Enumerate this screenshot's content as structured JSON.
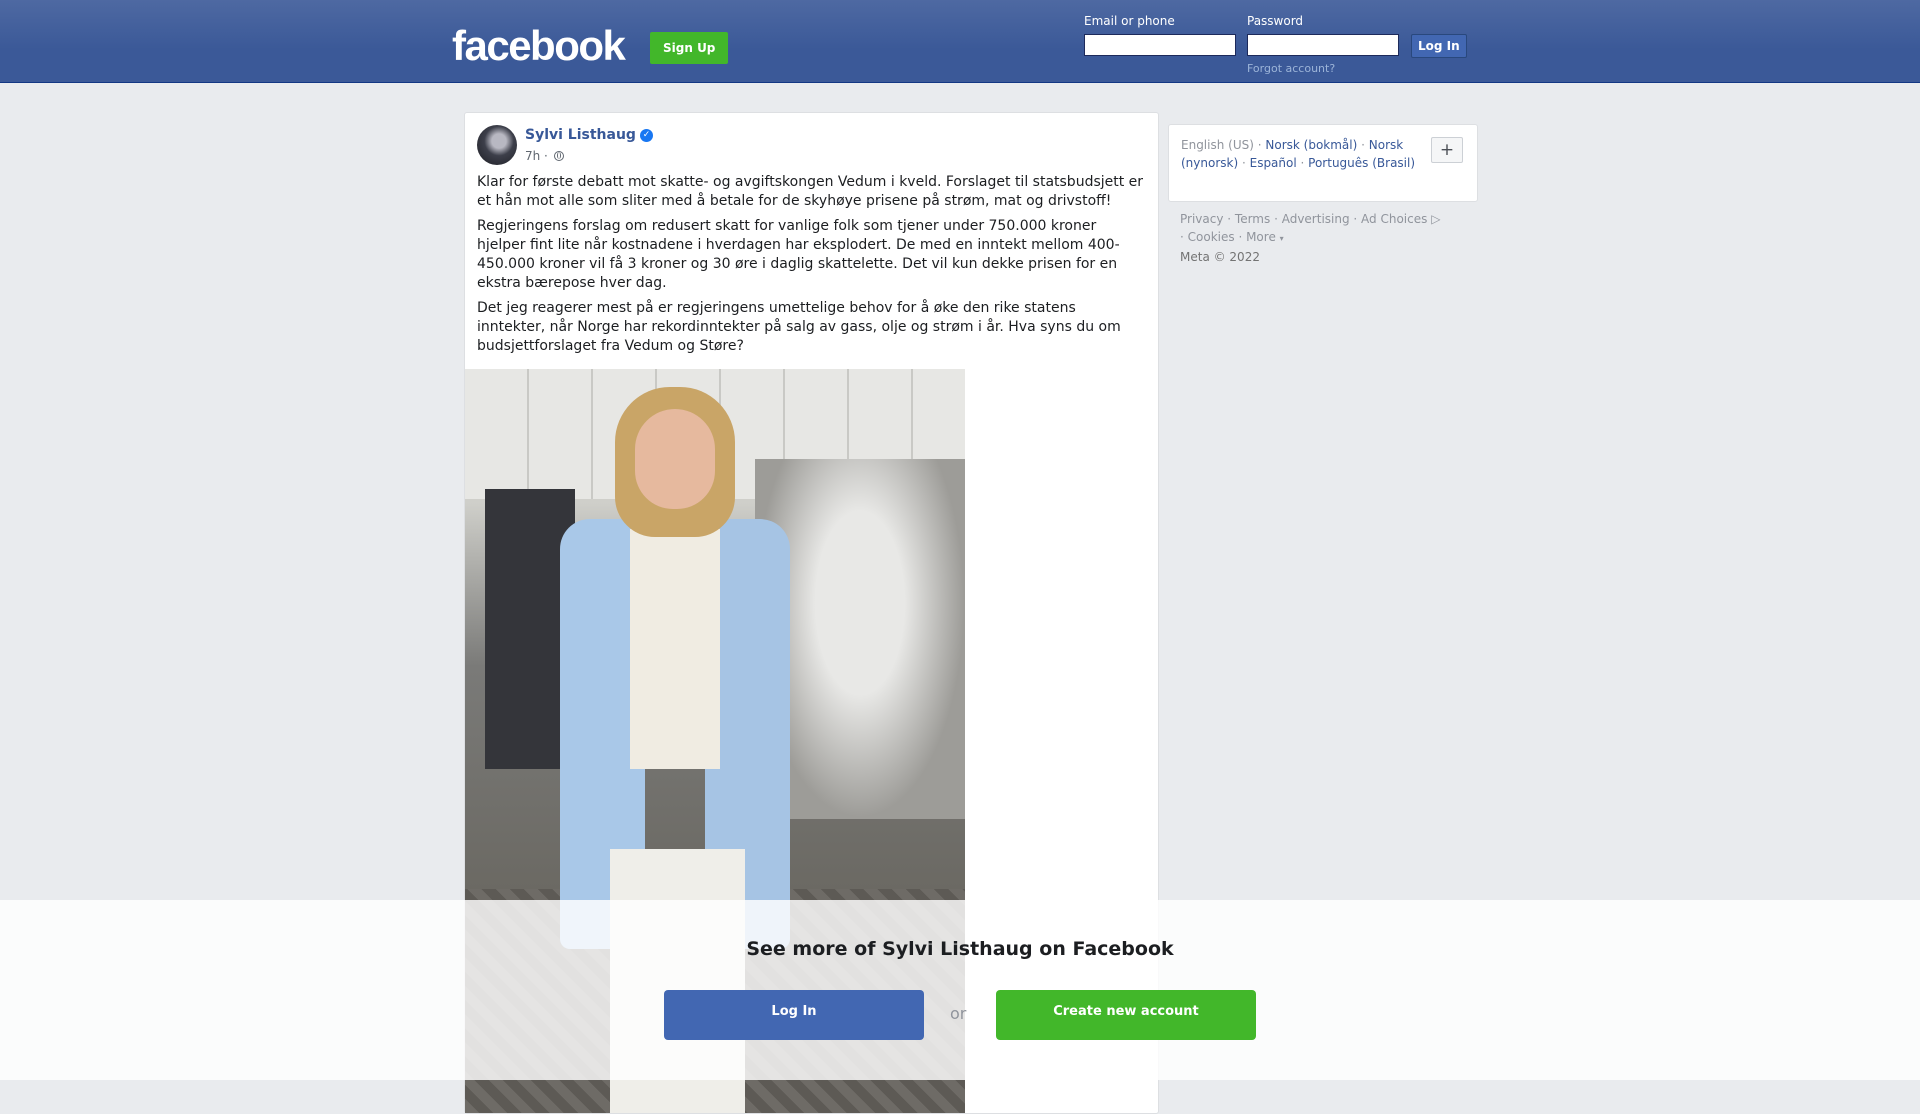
{
  "header": {
    "logo": "facebook",
    "signup_label": "Sign Up",
    "email_label": "Email or phone",
    "password_label": "Password",
    "login_label": "Log In",
    "forgot_label": "Forgot account?"
  },
  "post": {
    "author": "Sylvi Listhaug",
    "time": "7h ·",
    "paragraphs": [
      "Klar for første debatt mot skatte- og avgiftskongen Vedum i kveld. Forslaget til statsbudsjett er et hån mot alle som sliter med å betale for de skyhøye prisene på strøm, mat og drivstoff!",
      "Regjeringens forslag om redusert skatt for vanlige folk som tjener under 750.000 kroner hjelper fint lite når kostnadene i hverdagen har eksplodert. De med en inntekt mellom 400-450.000 kroner vil få 3 kroner og 30 øre i daglig skattelette. Det vil kun dekke prisen for en ekstra bærepose hver dag.",
      "Det jeg reagerer mest på er regjeringens umettelige behov for å øke den rike statens inntekter, når Norge har rekordinntekter på salg av gass, olje og strøm i år. Hva syns du om budsjettforslaget fra Vedum og Støre?"
    ]
  },
  "languages": {
    "current": "English (US)",
    "items": [
      "Norsk (bokmål)",
      "Norsk (nynorsk)",
      "Español",
      "Português (Brasil)"
    ],
    "add_label": "+"
  },
  "footer": {
    "links": [
      "Privacy",
      "Terms",
      "Advertising",
      "Ad Choices",
      "Cookies",
      "More"
    ],
    "copyright": "Meta © 2022"
  },
  "overlay": {
    "title": "See more of Sylvi Listhaug on Facebook",
    "login_label": "Log In",
    "or_label": "or",
    "create_label": "Create new account"
  }
}
